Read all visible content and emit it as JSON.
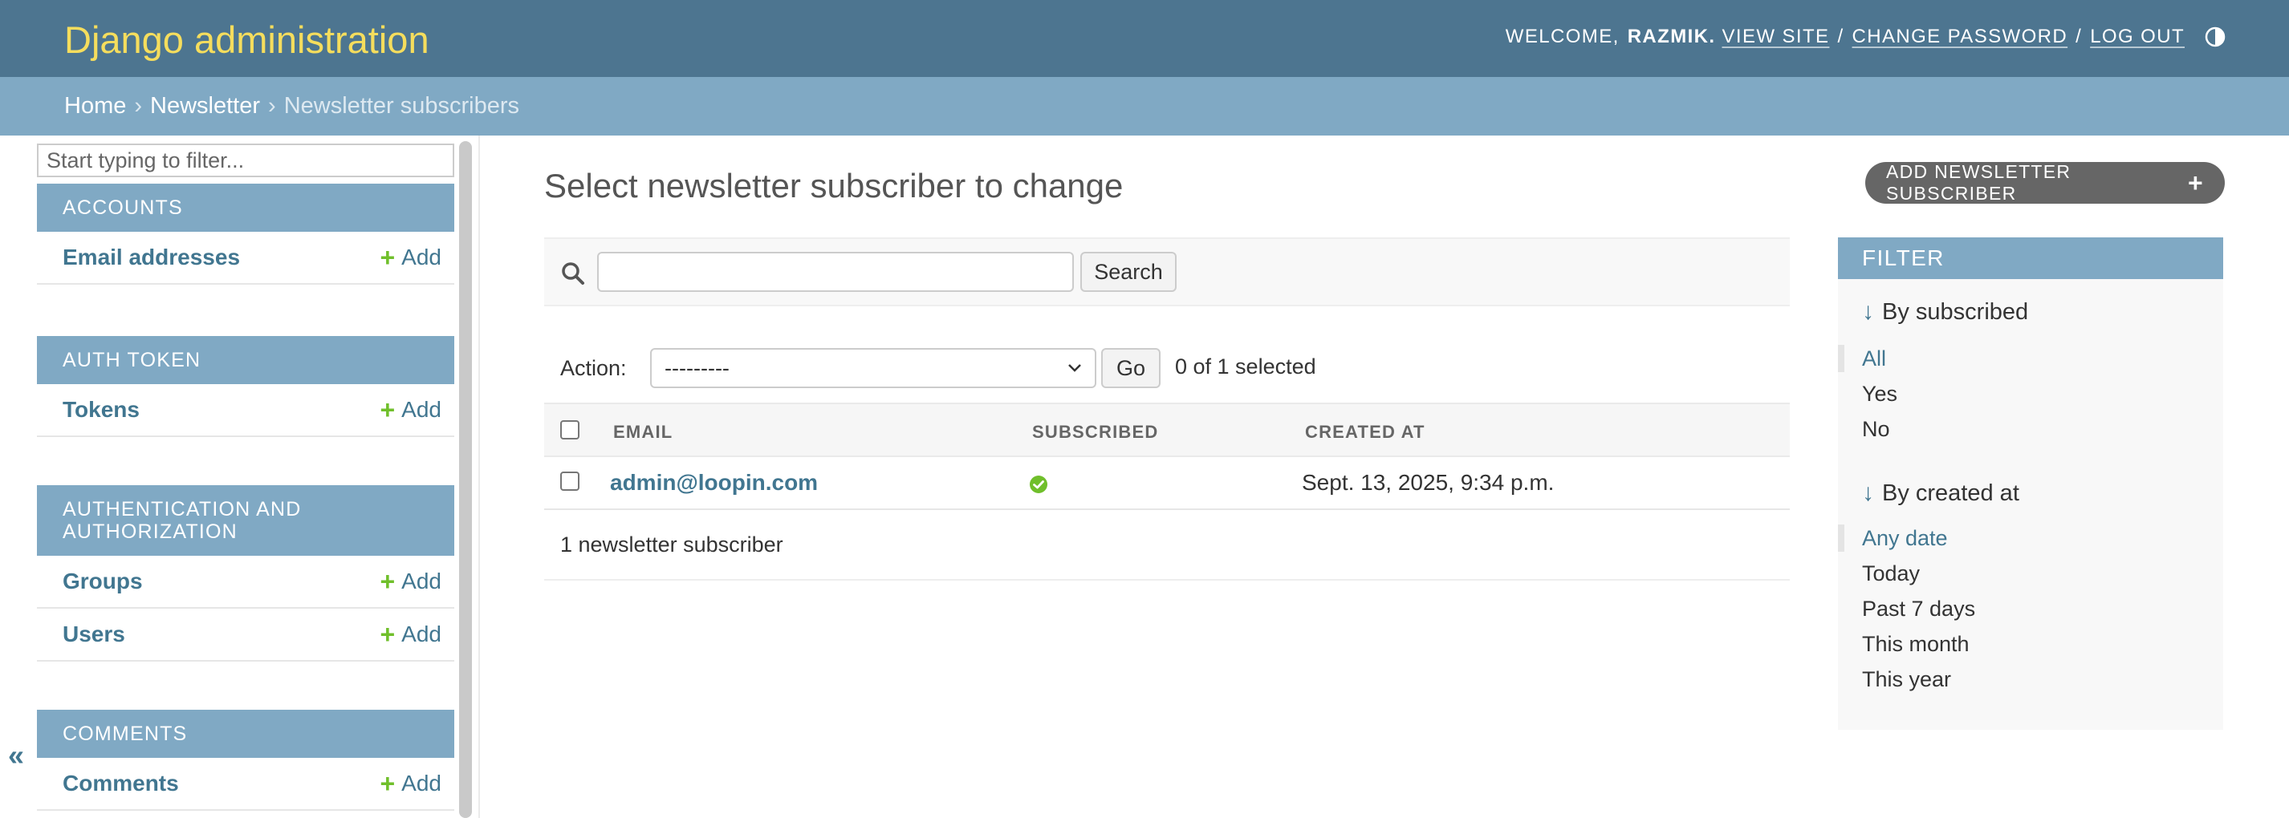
{
  "header": {
    "site_name": "Django administration",
    "welcome": "WELCOME,",
    "username": "RAZMIK.",
    "view_site": "VIEW SITE",
    "change_password": "CHANGE PASSWORD",
    "log_out": "LOG OUT",
    "separator": "/"
  },
  "breadcrumbs": {
    "home": "Home",
    "app": "Newsletter",
    "current": "Newsletter subscribers",
    "arrow": "›"
  },
  "sidebar": {
    "filter_placeholder": "Start typing to filter...",
    "collapse_glyph": "«",
    "add_label": "Add",
    "apps": [
      {
        "name": "ACCOUNTS",
        "models": [
          "Email addresses"
        ]
      },
      {
        "name": "AUTH TOKEN",
        "models": [
          "Tokens"
        ]
      },
      {
        "name": "AUTHENTICATION AND AUTHORIZATION",
        "models": [
          "Groups",
          "Users"
        ]
      },
      {
        "name": "COMMENTS",
        "models": [
          "Comments"
        ]
      }
    ]
  },
  "main": {
    "title": "Select newsletter subscriber to change",
    "add_button": "ADD NEWSLETTER SUBSCRIBER",
    "search": {
      "value": "",
      "button": "Search"
    },
    "actions": {
      "label": "Action:",
      "selected_option": "---------",
      "go": "Go",
      "selected_count": "0 of 1 selected"
    },
    "table": {
      "columns": [
        "EMAIL",
        "SUBSCRIBED",
        "CREATED AT"
      ],
      "rows": [
        {
          "email": "admin@loopin.com",
          "subscribed": true,
          "created_at": "Sept. 13, 2025, 9:34 p.m."
        }
      ]
    },
    "paginator": "1 newsletter subscriber"
  },
  "filter": {
    "title": "FILTER",
    "groups": [
      {
        "heading": "By subscribed",
        "options": [
          "All",
          "Yes",
          "No"
        ],
        "selected": "All"
      },
      {
        "heading": "By created at",
        "options": [
          "Any date",
          "Today",
          "Past 7 days",
          "This month",
          "This year"
        ],
        "selected": "Any date"
      }
    ]
  },
  "colors": {
    "header_bg": "#4d7590",
    "brand_text": "#f5dd5d",
    "breadcrumb_bg": "#80a9c4",
    "link": "#417690",
    "add_green": "#70bf2b"
  }
}
